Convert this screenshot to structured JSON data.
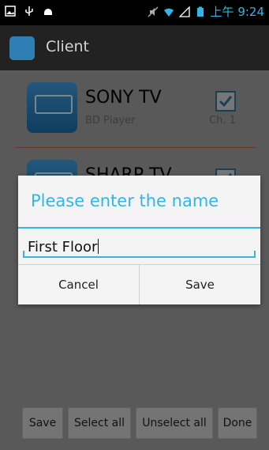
{
  "status": {
    "time": "上午 9:24",
    "left_icons": [
      "image-icon",
      "usb-icon",
      "android-icon"
    ],
    "right_icons": [
      "mute-icon",
      "wifi-icon",
      "signal-icon",
      "battery-icon"
    ]
  },
  "app": {
    "title": "Client",
    "icon": "app-icon"
  },
  "devices": [
    {
      "name": "SONY TV",
      "sub": "BD Player",
      "channel": "Ch. 1",
      "checked": true
    },
    {
      "name": "SHARP TV",
      "sub": "",
      "channel": "",
      "checked": true
    }
  ],
  "buttons": {
    "save": "Save",
    "select_all": "Select all",
    "unselect_all": "Unselect all",
    "done": "Done"
  },
  "dialog": {
    "title": "Please enter the name",
    "input_value": "First Floor",
    "cancel": "Cancel",
    "save": "Save"
  },
  "colors": {
    "accent": "#33b5e5",
    "dialog_bg": "#f4f4f4",
    "status_bg": "#000000",
    "action_bg": "#222222"
  }
}
